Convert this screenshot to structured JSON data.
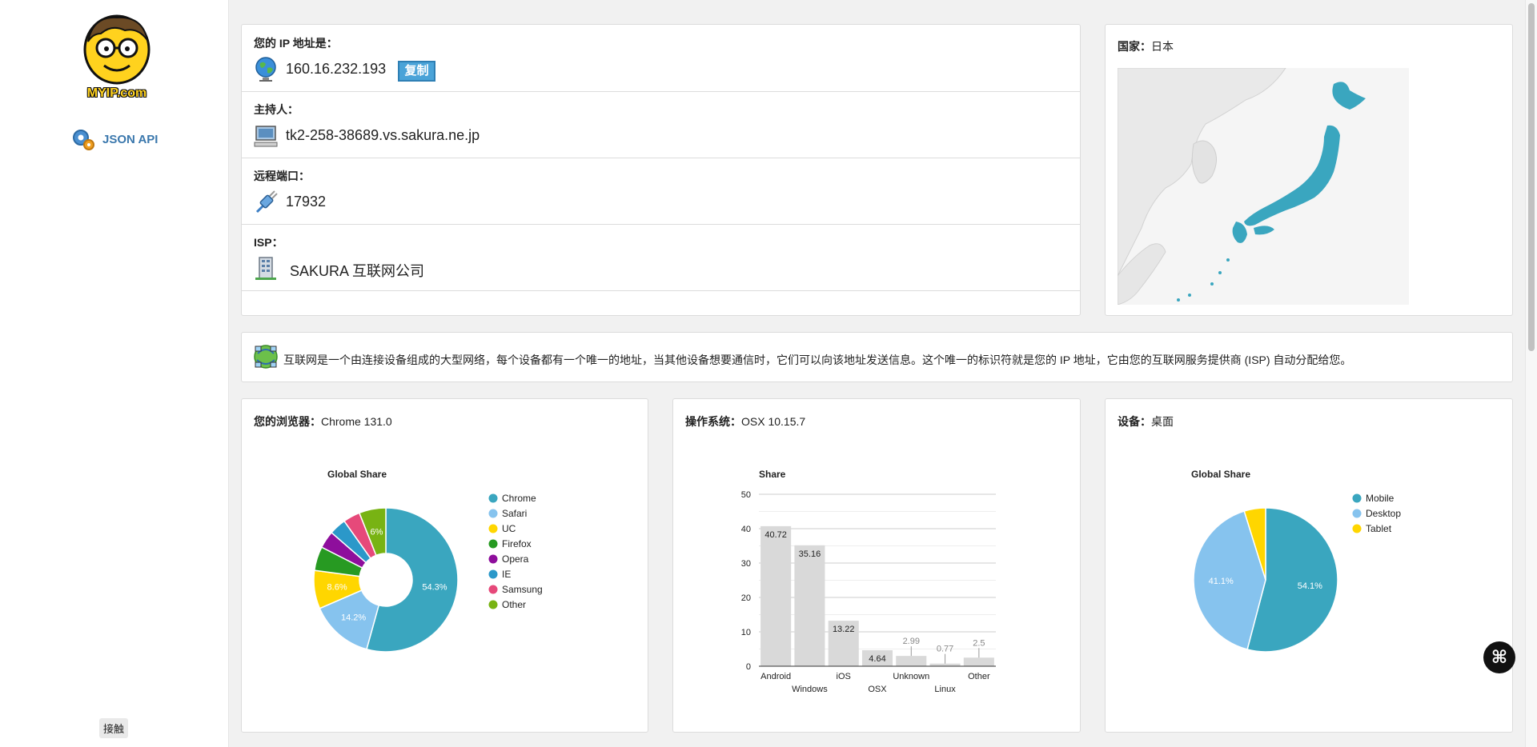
{
  "sidebar": {
    "logo_text": "MYIP.com",
    "api_label": "JSON API",
    "contact_label": "接触"
  },
  "ip_panel": {
    "ip": {
      "label": "您的 IP 地址是：",
      "value": "160.16.232.193",
      "copy_label": "复制",
      "icon": "globe-icon"
    },
    "host": {
      "label": "主持人：",
      "value": "tk2-258-38689.vs.sakura.ne.jp",
      "icon": "computer-icon"
    },
    "port": {
      "label": "远程端口：",
      "value": "17932",
      "icon": "port-plug-icon"
    },
    "isp": {
      "label": "ISP：",
      "value": "SAKURA 互联网公司",
      "icon": "building-icon"
    }
  },
  "country": {
    "label": "国家：",
    "value": "日本",
    "highlight_color": "#3aa6bf"
  },
  "description": {
    "text": "互联网是一个由连接设备组成的大型网络，每个设备都有一个唯一的地址，当其他设备想要通信时，它们可以向该地址发送信息。这个唯一的标识符就是您的 IP 地址，它由您的互联网服务提供商 (ISP) 自动分配给您。",
    "icon": "network-globe-icon"
  },
  "browser": {
    "label": "您的浏览器：",
    "value": "Chrome 131.0"
  },
  "os": {
    "label": "操作系统：",
    "value": "OSX 10.15.7"
  },
  "device": {
    "label": "设备：",
    "value": "桌面"
  },
  "chart_data": [
    {
      "type": "pie",
      "variant": "donut",
      "title": "Global Share",
      "legend_position": "right",
      "labels": [
        "Chrome",
        "Safari",
        "UC",
        "Firefox",
        "Opera",
        "IE",
        "Samsung",
        "Other"
      ],
      "values": [
        54.3,
        14.2,
        8.6,
        5.4,
        3.9,
        3.8,
        3.8,
        6.0
      ],
      "value_labels": [
        "54.3%",
        "14.2%",
        "8.6%",
        "",
        "",
        "",
        "",
        "6%"
      ],
      "colors": [
        "#3aa6bf",
        "#86c3ee",
        "#ffd600",
        "#279a22",
        "#8e0e9c",
        "#2b98c9",
        "#e6497a",
        "#78b313"
      ]
    },
    {
      "type": "bar",
      "title": "Share",
      "categories": [
        "Android",
        "Windows",
        "iOS",
        "OSX",
        "Unknown",
        "Linux",
        "Other"
      ],
      "values": [
        40.72,
        35.16,
        13.22,
        4.64,
        2.99,
        0.77,
        2.5
      ],
      "ylim": [
        0,
        50
      ],
      "yticks": [
        0,
        10,
        20,
        30,
        40,
        50
      ],
      "grid": true,
      "bar_color": "#d9d9d9"
    },
    {
      "type": "pie",
      "title": "Global Share",
      "legend_position": "right",
      "labels": [
        "Mobile",
        "Desktop",
        "Tablet"
      ],
      "values": [
        54.1,
        41.1,
        4.8
      ],
      "value_labels": [
        "54.1%",
        "41.1%",
        ""
      ],
      "colors": [
        "#3aa6bf",
        "#86c3ee",
        "#ffd600"
      ]
    }
  ]
}
